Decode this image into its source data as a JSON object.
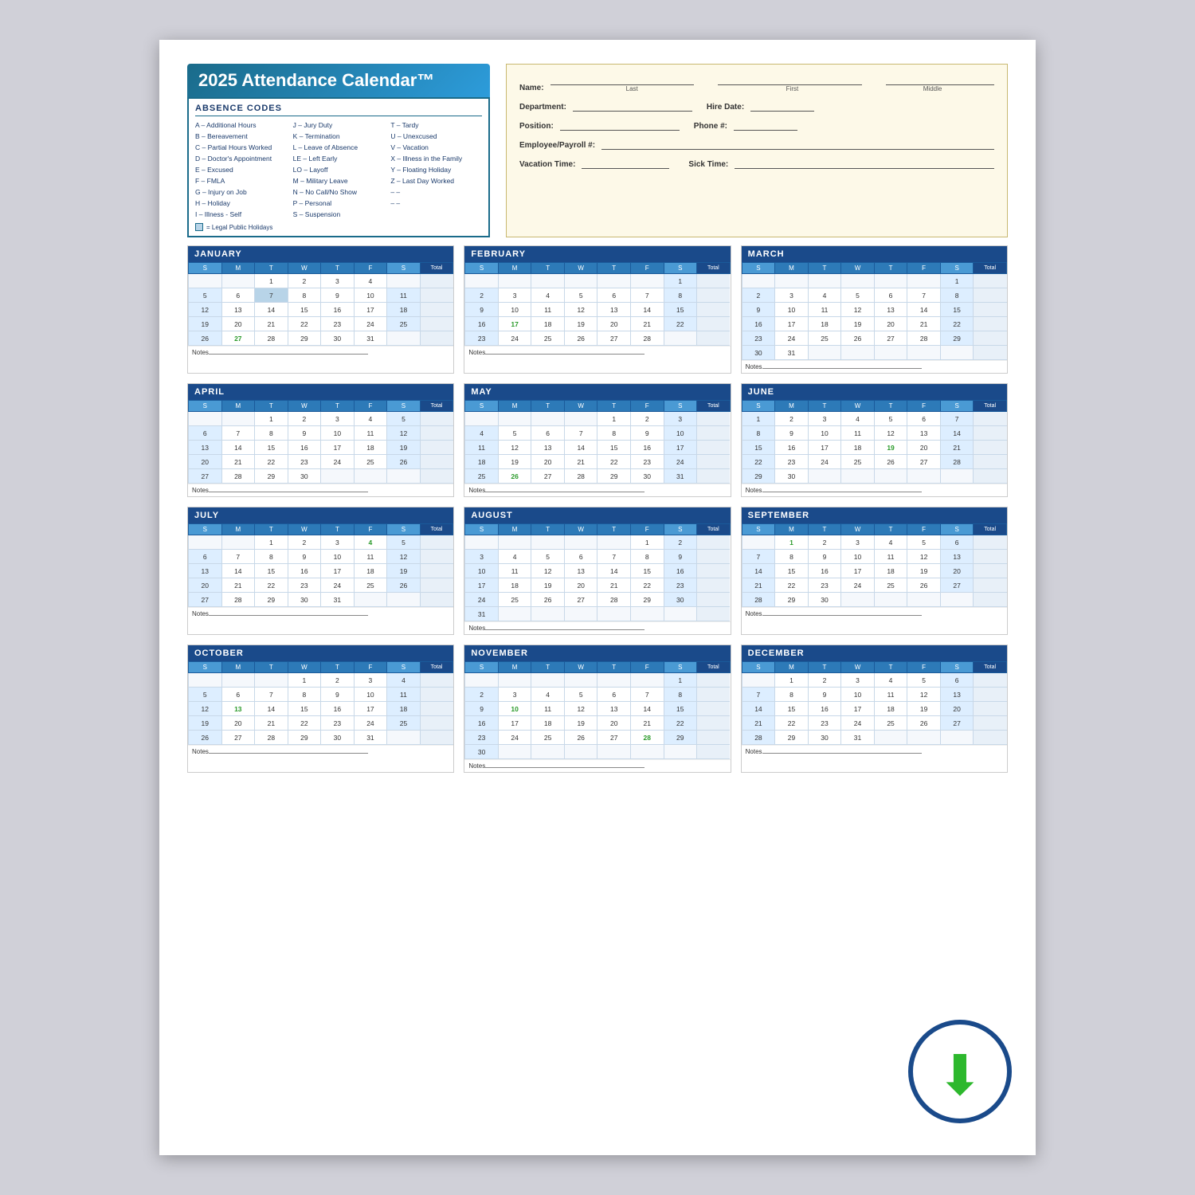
{
  "page": {
    "title": "2025 Attendance Calendar™",
    "absence_section_title": "ABSENCE CODES",
    "codes_col1": [
      "A – Additional Hours",
      "B – Bereavement",
      "C – Partial Hours Worked",
      "D – Doctor's Appointment",
      "E – Excused",
      "F – FMLA",
      "G – Injury on Job",
      "H – Holiday",
      "I  – Illness - Self"
    ],
    "codes_col2": [
      "J  – Jury Duty",
      "K – Termination",
      "L  – Leave of Absence",
      "LE – Left Early",
      "LO – Layoff",
      "M – Military Leave",
      "N – No Call/No Show",
      "P  – Personal",
      "S  – Suspension"
    ],
    "codes_col3": [
      "T – Tardy",
      "U – Unexcused",
      "V – Vacation",
      "X – Illness in the Family",
      "Y – Floating Holiday",
      "Z – Last Day Worked",
      "– –",
      "– –"
    ],
    "legend_note": "= Legal Public Holidays",
    "form": {
      "name_label": "Name:",
      "last_label": "Last",
      "first_label": "First",
      "middle_label": "Middle",
      "dept_label": "Department:",
      "hire_label": "Hire Date:",
      "hire_format": "/ /",
      "position_label": "Position:",
      "phone_label": "Phone #:",
      "phone_format": "(   )",
      "emp_label": "Employee/Payroll #:",
      "vacation_label": "Vacation Time:",
      "sick_label": "Sick Time:"
    },
    "months": [
      {
        "name": "JANUARY",
        "days": [
          [
            "",
            "",
            "1",
            "2",
            "3",
            "4",
            ""
          ],
          [
            "5",
            "6",
            "7",
            "8",
            "9",
            "10",
            "11"
          ],
          [
            "12",
            "13",
            "14",
            "15",
            "16",
            "17",
            "18"
          ],
          [
            "19",
            "20",
            "21",
            "22",
            "23",
            "24",
            "25"
          ],
          [
            "26",
            "27",
            "28",
            "29",
            "30",
            "31",
            ""
          ]
        ],
        "holidays": {
          "1,2": "holiday"
        },
        "highlights": {
          "4,1": "green"
        }
      },
      {
        "name": "FEBRUARY",
        "days": [
          [
            "",
            "",
            "",
            "",
            "",
            "",
            "1"
          ],
          [
            "2",
            "3",
            "4",
            "5",
            "6",
            "7",
            "8"
          ],
          [
            "9",
            "10",
            "11",
            "12",
            "13",
            "14",
            "15"
          ],
          [
            "16",
            "17",
            "18",
            "19",
            "20",
            "21",
            "22"
          ],
          [
            "23",
            "24",
            "25",
            "26",
            "27",
            "28",
            ""
          ]
        ],
        "holidays": {},
        "highlights": {
          "3,1": "green"
        }
      },
      {
        "name": "MARCH",
        "days": [
          [
            "",
            "",
            "",
            "",
            "",
            "",
            "1"
          ],
          [
            "2",
            "3",
            "4",
            "5",
            "6",
            "7",
            "8"
          ],
          [
            "9",
            "10",
            "11",
            "12",
            "13",
            "14",
            "15"
          ],
          [
            "16",
            "17",
            "18",
            "19",
            "20",
            "21",
            "22"
          ],
          [
            "23",
            "24",
            "25",
            "26",
            "27",
            "28",
            "29"
          ],
          [
            "30",
            "31",
            "",
            "",
            "",
            "",
            ""
          ]
        ],
        "holidays": {},
        "highlights": {}
      },
      {
        "name": "APRIL",
        "days": [
          [
            "",
            "",
            "1",
            "2",
            "3",
            "4",
            "5"
          ],
          [
            "6",
            "7",
            "8",
            "9",
            "10",
            "11",
            "12"
          ],
          [
            "13",
            "14",
            "15",
            "16",
            "17",
            "18",
            "19"
          ],
          [
            "20",
            "21",
            "22",
            "23",
            "24",
            "25",
            "26"
          ],
          [
            "27",
            "28",
            "29",
            "30",
            "",
            "",
            ""
          ]
        ],
        "holidays": {},
        "highlights": {}
      },
      {
        "name": "MAY",
        "days": [
          [
            "",
            "",
            "",
            "",
            "1",
            "2",
            "3"
          ],
          [
            "4",
            "5",
            "6",
            "7",
            "8",
            "9",
            "10"
          ],
          [
            "11",
            "12",
            "13",
            "14",
            "15",
            "16",
            "17"
          ],
          [
            "18",
            "19",
            "20",
            "21",
            "22",
            "23",
            "24"
          ],
          [
            "25",
            "26",
            "27",
            "28",
            "29",
            "30",
            "31"
          ]
        ],
        "holidays": {},
        "highlights": {
          "4,1": "green"
        }
      },
      {
        "name": "JUNE",
        "days": [
          [
            "1",
            "2",
            "3",
            "4",
            "5",
            "6",
            "7"
          ],
          [
            "8",
            "9",
            "10",
            "11",
            "12",
            "13",
            "14"
          ],
          [
            "15",
            "16",
            "17",
            "18",
            "19",
            "20",
            "21"
          ],
          [
            "22",
            "23",
            "24",
            "25",
            "26",
            "27",
            "28"
          ],
          [
            "29",
            "30",
            "",
            "",
            "",
            "",
            ""
          ]
        ],
        "holidays": {},
        "highlights": {
          "2,4": "green"
        }
      },
      {
        "name": "JULY",
        "days": [
          [
            "",
            "",
            "1",
            "2",
            "3",
            "4",
            "5"
          ],
          [
            "6",
            "7",
            "8",
            "9",
            "10",
            "11",
            "12"
          ],
          [
            "13",
            "14",
            "15",
            "16",
            "17",
            "18",
            "19"
          ],
          [
            "20",
            "21",
            "22",
            "23",
            "24",
            "25",
            "26"
          ],
          [
            "27",
            "28",
            "29",
            "30",
            "31",
            "",
            ""
          ]
        ],
        "holidays": {},
        "highlights": {
          "0,5": "green"
        }
      },
      {
        "name": "AUGUST",
        "days": [
          [
            "",
            "",
            "",
            "",
            "",
            "1",
            "2"
          ],
          [
            "3",
            "4",
            "5",
            "6",
            "7",
            "8",
            "9"
          ],
          [
            "10",
            "11",
            "12",
            "13",
            "14",
            "15",
            "16"
          ],
          [
            "17",
            "18",
            "19",
            "20",
            "21",
            "22",
            "23"
          ],
          [
            "24",
            "25",
            "26",
            "27",
            "28",
            "29",
            "30"
          ],
          [
            "31",
            "",
            "",
            "",
            "",
            "",
            ""
          ]
        ],
        "holidays": {},
        "highlights": {}
      },
      {
        "name": "SEPTEMBER",
        "days": [
          [
            "",
            "1",
            "2",
            "3",
            "4",
            "5",
            "6"
          ],
          [
            "7",
            "8",
            "9",
            "10",
            "11",
            "12",
            "13"
          ],
          [
            "14",
            "15",
            "16",
            "17",
            "18",
            "19",
            "20"
          ],
          [
            "21",
            "22",
            "23",
            "24",
            "25",
            "26",
            "27"
          ],
          [
            "28",
            "29",
            "30",
            "",
            "",
            "",
            ""
          ]
        ],
        "holidays": {},
        "highlights": {
          "0,1": "green"
        }
      },
      {
        "name": "OCTOBER",
        "days": [
          [
            "",
            "",
            "",
            "1",
            "2",
            "3",
            "4"
          ],
          [
            "5",
            "6",
            "7",
            "8",
            "9",
            "10",
            "11"
          ],
          [
            "12",
            "13",
            "14",
            "15",
            "16",
            "17",
            "18"
          ],
          [
            "19",
            "20",
            "21",
            "22",
            "23",
            "24",
            "25"
          ],
          [
            "26",
            "27",
            "28",
            "29",
            "30",
            "31",
            ""
          ]
        ],
        "holidays": {},
        "highlights": {
          "2,1": "green"
        }
      },
      {
        "name": "NOVEMBER",
        "days": [
          [
            "",
            "",
            "",
            "",
            "",
            "",
            "1"
          ],
          [
            "2",
            "3",
            "4",
            "5",
            "6",
            "7",
            "8"
          ],
          [
            "9",
            "10",
            "11",
            "12",
            "13",
            "14",
            "15"
          ],
          [
            "16",
            "17",
            "18",
            "19",
            "20",
            "21",
            "22"
          ],
          [
            "23",
            "24",
            "25",
            "26",
            "27",
            "28",
            "29"
          ],
          [
            "30",
            "",
            "",
            "",
            "",
            "",
            ""
          ]
        ],
        "holidays": {},
        "highlights": {
          "2,1": "green",
          "4,5": "green"
        }
      },
      {
        "name": "DECEMBER",
        "days": [
          [
            "",
            "1",
            "2",
            "3",
            "4",
            "5",
            "6"
          ],
          [
            "7",
            "8",
            "9",
            "10",
            "11",
            "12",
            "13"
          ],
          [
            "14",
            "15",
            "16",
            "17",
            "18",
            "19",
            "20"
          ],
          [
            "21",
            "22",
            "23",
            "24",
            "25",
            "26",
            "27"
          ],
          [
            "28",
            "29",
            "30",
            "31",
            "",
            "",
            ""
          ]
        ],
        "holidays": {},
        "highlights": {}
      }
    ],
    "days_header": [
      "S",
      "M",
      "T",
      "W",
      "T",
      "F",
      "S",
      "Total"
    ],
    "notes_label": "Notes",
    "download_label": "Download"
  }
}
